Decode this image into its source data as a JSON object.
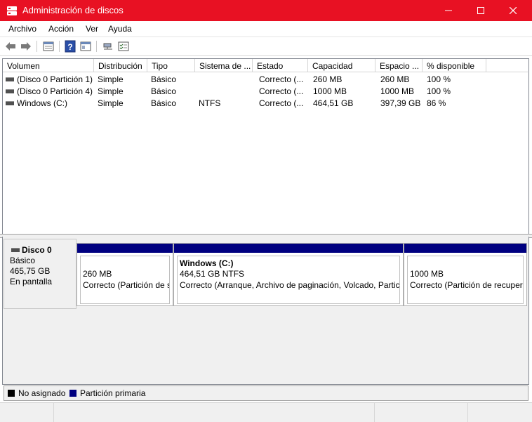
{
  "window": {
    "title": "Administración de discos",
    "titlebar_color": "#e81123"
  },
  "menu": [
    "Archivo",
    "Acción",
    "Ver",
    "Ayuda"
  ],
  "toolbar": {
    "icons": [
      "back-arrow-icon",
      "forward-arrow-icon",
      "properties-icon",
      "help-icon",
      "console-icon",
      "connect-icon",
      "checklist-icon"
    ]
  },
  "volume_list": {
    "columns": [
      "Volumen",
      "Distribución",
      "Tipo",
      "Sistema de ...",
      "Estado",
      "Capacidad",
      "Espacio ...",
      "% disponible"
    ],
    "rows": [
      [
        "(Disco 0 Partición 1)",
        "Simple",
        "Básico",
        "",
        "Correcto (...",
        "260 MB",
        "260 MB",
        "100 %"
      ],
      [
        "(Disco 0 Partición 4)",
        "Simple",
        "Básico",
        "",
        "Correcto (...",
        "1000 MB",
        "1000 MB",
        "100 %"
      ],
      [
        "Windows (C:)",
        "Simple",
        "Básico",
        "NTFS",
        "Correcto (...",
        "464,51 GB",
        "397,39 GB",
        "86 %"
      ]
    ]
  },
  "disk": {
    "name": "Disco 0",
    "type": "Básico",
    "size": "465,75 GB",
    "status": "En pantalla",
    "partitions": [
      {
        "title": "",
        "size": "260 MB",
        "status": "Correcto (Partición de s"
      },
      {
        "title": "Windows  (C:)",
        "size": "464,51 GB NTFS",
        "status": "Correcto (Arranque, Archivo de paginación, Volcado, Partic"
      },
      {
        "title": "",
        "size": "1000 MB",
        "status": "Correcto (Partición de recuper"
      }
    ]
  },
  "legend": [
    {
      "label": "No asignado",
      "color": "#000000"
    },
    {
      "label": "Partición primaria",
      "color": "#000080"
    }
  ]
}
